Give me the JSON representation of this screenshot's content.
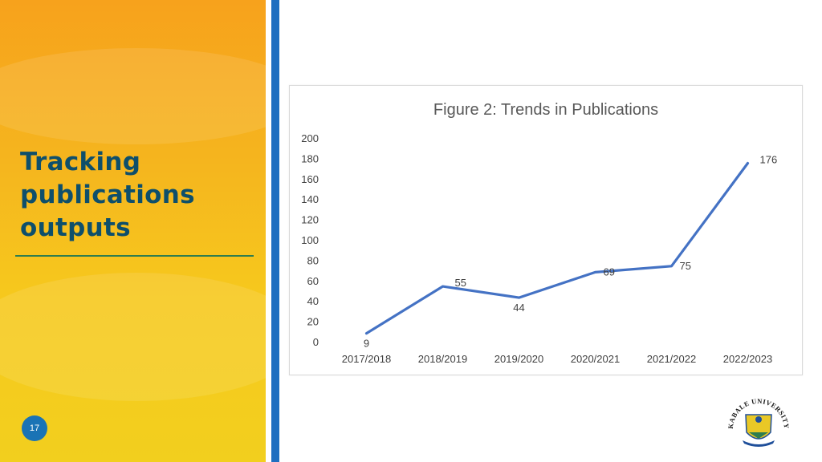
{
  "slide": {
    "title_lines": [
      "Tracking",
      "publications",
      "outputs"
    ],
    "page_number": "17"
  },
  "logo": {
    "text": "KABALE UNIVERSITY"
  },
  "colors": {
    "panel_top": "#f7a21c",
    "panel_bottom": "#f2cf1e",
    "title": "#0e4f6b",
    "accent_bar": "#1f6fc0",
    "rule": "#2e7d4f",
    "series_line": "#4472c4"
  },
  "chart_data": {
    "type": "line",
    "title": "Figure 2: Trends in Publications",
    "categories": [
      "2017/2018",
      "2018/2019",
      "2019/2020",
      "2020/2021",
      "2021/2022",
      "2022/2023"
    ],
    "series": [
      {
        "values": [
          9,
          55,
          44,
          69,
          75,
          176
        ],
        "data_labels": [
          "9",
          "55",
          "44",
          "69",
          "75",
          "176"
        ]
      }
    ],
    "ylim": [
      0,
      200
    ],
    "yticks": [
      0,
      20,
      40,
      60,
      80,
      100,
      120,
      140,
      160,
      180,
      200
    ],
    "grid": false,
    "legend": "none"
  }
}
